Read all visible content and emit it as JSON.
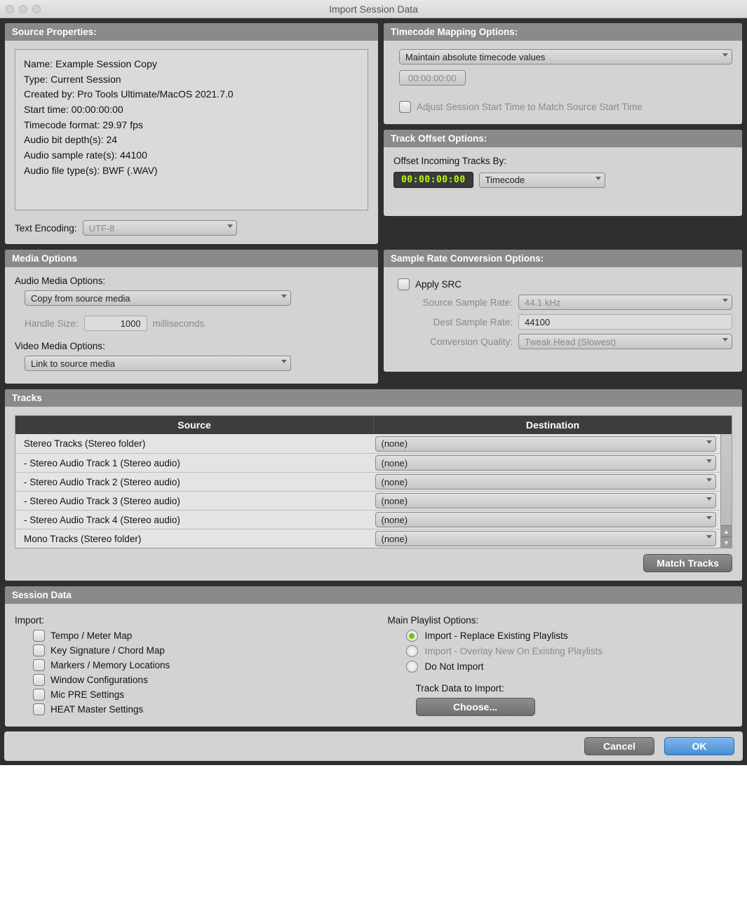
{
  "window": {
    "title": "Import Session Data"
  },
  "source_properties": {
    "header": "Source Properties:",
    "lines": {
      "name": "Name: Example Session Copy",
      "type": "Type: Current Session",
      "created": "Created by: Pro Tools Ultimate/MacOS 2021.7.0",
      "start": "Start time: 00:00:00:00",
      "tcfmt": "Timecode format: 29.97 fps",
      "bit": "Audio bit depth(s): 24",
      "sr": "Audio sample rate(s): 44100",
      "ftype": "Audio file type(s): BWF (.WAV)"
    },
    "text_encoding_label": "Text Encoding:",
    "text_encoding_value": "UTF-8"
  },
  "timecode": {
    "header": "Timecode Mapping Options:",
    "mode": "Maintain absolute timecode values",
    "value": "00:00:00:00",
    "adjust_label": "Adjust Session Start Time to Match Source Start Time"
  },
  "offset": {
    "header": "Track Offset Options:",
    "label": "Offset Incoming Tracks By:",
    "value": "00:00:00:00",
    "unit": "Timecode"
  },
  "media": {
    "header": "Media Options",
    "audio_label": "Audio Media Options:",
    "audio_value": "Copy from source media",
    "handle_label": "Handle Size:",
    "handle_value": "1000",
    "handle_unit": "milliseconds",
    "video_label": "Video Media Options:",
    "video_value": "Link to source media"
  },
  "src": {
    "header": "Sample Rate Conversion Options:",
    "apply_label": "Apply SRC",
    "source_label": "Source Sample Rate:",
    "source_value": "44.1 kHz",
    "dest_label": "Dest Sample Rate:",
    "dest_value": "44100",
    "quality_label": "Conversion Quality:",
    "quality_value": "Tweak Head (Slowest)"
  },
  "tracks": {
    "header": "Tracks",
    "col_source": "Source",
    "col_dest": "Destination",
    "rows": [
      {
        "src": "Stereo Tracks (Stereo folder)",
        "dst": "(none)"
      },
      {
        "src": " - Stereo Audio Track 1 (Stereo audio)",
        "dst": "(none)"
      },
      {
        "src": " - Stereo Audio Track 2 (Stereo audio)",
        "dst": "(none)"
      },
      {
        "src": " - Stereo Audio Track 3 (Stereo audio)",
        "dst": "(none)"
      },
      {
        "src": " - Stereo Audio Track 4 (Stereo audio)",
        "dst": "(none)"
      },
      {
        "src": "Mono Tracks (Stereo folder)",
        "dst": "(none)"
      }
    ],
    "match_button": "Match Tracks"
  },
  "session_data": {
    "header": "Session Data",
    "import_label": "Import:",
    "opts": {
      "tempo": "Tempo / Meter Map",
      "key": "Key Signature / Chord Map",
      "markers": "Markers / Memory Locations",
      "window": "Window Configurations",
      "micpre": "Mic PRE Settings",
      "heat": "HEAT Master Settings"
    },
    "playlist_label": "Main Playlist Options:",
    "playlist": {
      "replace": "Import - Replace Existing Playlists",
      "overlay": "Import - Overlay New On Existing Playlists",
      "none": "Do Not Import"
    },
    "track_data_label": "Track Data to Import:",
    "choose": "Choose..."
  },
  "footer": {
    "cancel": "Cancel",
    "ok": "OK"
  }
}
